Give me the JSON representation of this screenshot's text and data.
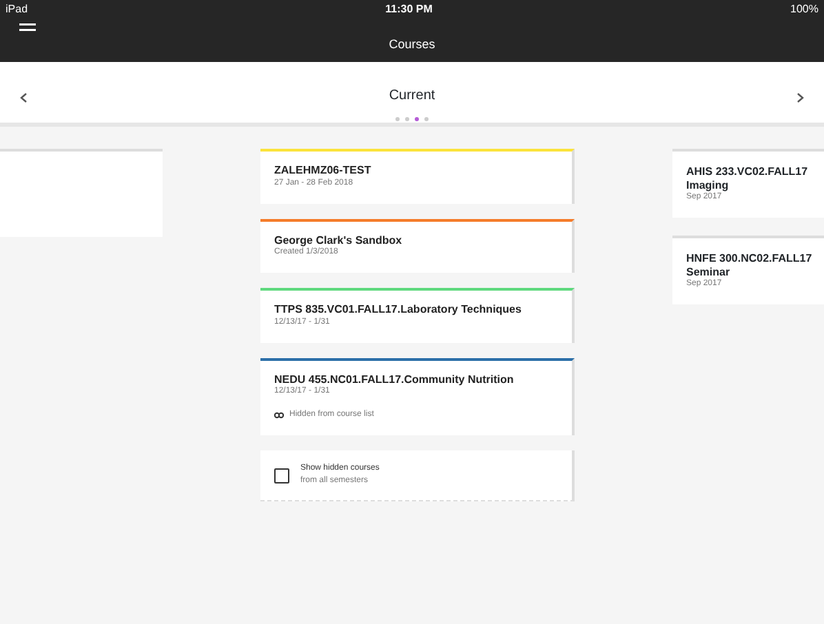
{
  "status_bar": {
    "carrier": "iPad",
    "time": "11:30 PM",
    "battery": "100%"
  },
  "nav_bar": {
    "title": "Courses"
  },
  "header": {
    "title": "Current",
    "pages": [
      {
        "selected": false
      },
      {
        "selected": false
      },
      {
        "selected": true
      },
      {
        "selected": false
      }
    ]
  },
  "left_cards": [
    {
      "kind": "empty"
    }
  ],
  "center_cards": [
    {
      "kind": "course",
      "color": "#fbe33b",
      "title": "ZALEHMZ06-TEST",
      "subtitle": "27 Jan - 28 Feb 2018"
    },
    {
      "kind": "course",
      "color": "#f57c2a",
      "title": "George Clark's Sandbox",
      "subtitle": "Created 1/3/2018"
    },
    {
      "kind": "course",
      "color": "#5fd97e",
      "title": "TTPS 835.VC01.FALL17.Laboratory Techniques",
      "subtitle": "12/13/17 - 1/31"
    },
    {
      "kind": "course",
      "color": "#2c6fa8",
      "title": "NEDU 455.NC01.FALL17.Community Nutrition",
      "subtitle": "12/13/17 - 1/31",
      "note": "Hidden from course list"
    },
    {
      "kind": "toggle",
      "checked": false,
      "title": "Show hidden courses",
      "subtitle": "from all semesters"
    }
  ],
  "right_cards": [
    {
      "title": "AHIS 233.VC02.FALL17",
      "title_2": "Imaging",
      "subtitle": "Sep 2017"
    },
    {
      "title": "HNFE 300.NC02.FALL17",
      "title_2": "Seminar",
      "subtitle": "Sep 2017"
    }
  ]
}
